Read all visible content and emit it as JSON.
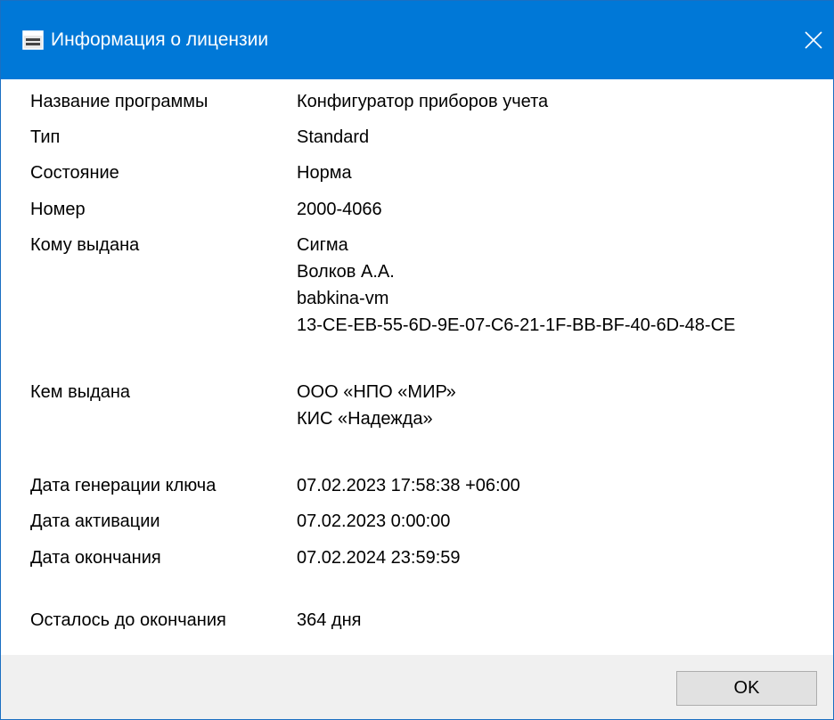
{
  "window": {
    "title": "Информация о лицензии",
    "accent_color": "#0078d7",
    "title_icon": "window-app-icon",
    "close_icon": "close-icon"
  },
  "fields": {
    "program_name": {
      "label": "Название программы",
      "value": "Конфигуратор приборов учета"
    },
    "type": {
      "label": "Тип",
      "value": "Standard"
    },
    "status": {
      "label": "Состояние",
      "value": "Норма"
    },
    "number": {
      "label": "Номер",
      "value": "2000-4066"
    },
    "issued_to": {
      "label": "Кому выдана",
      "lines": [
        "Сигма",
        "Волков А.А.",
        "babkina-vm",
        "13-CE-EB-55-6D-9E-07-C6-21-1F-BB-BF-40-6D-48-CE"
      ]
    },
    "issued_by": {
      "label": "Кем выдана",
      "lines": [
        "ООО «НПО «МИР»",
        "КИС «Надежда»"
      ]
    },
    "key_generated": {
      "label": "Дата генерации ключа",
      "value": "07.02.2023 17:58:38 +06:00"
    },
    "activated": {
      "label": "Дата активации",
      "value": "07.02.2023 0:00:00"
    },
    "expires": {
      "label": "Дата окончания",
      "value": "07.02.2024 23:59:59"
    },
    "remaining": {
      "label": "Осталось до окончания",
      "value": "364 дня"
    }
  },
  "footer": {
    "ok_label": "OK"
  }
}
